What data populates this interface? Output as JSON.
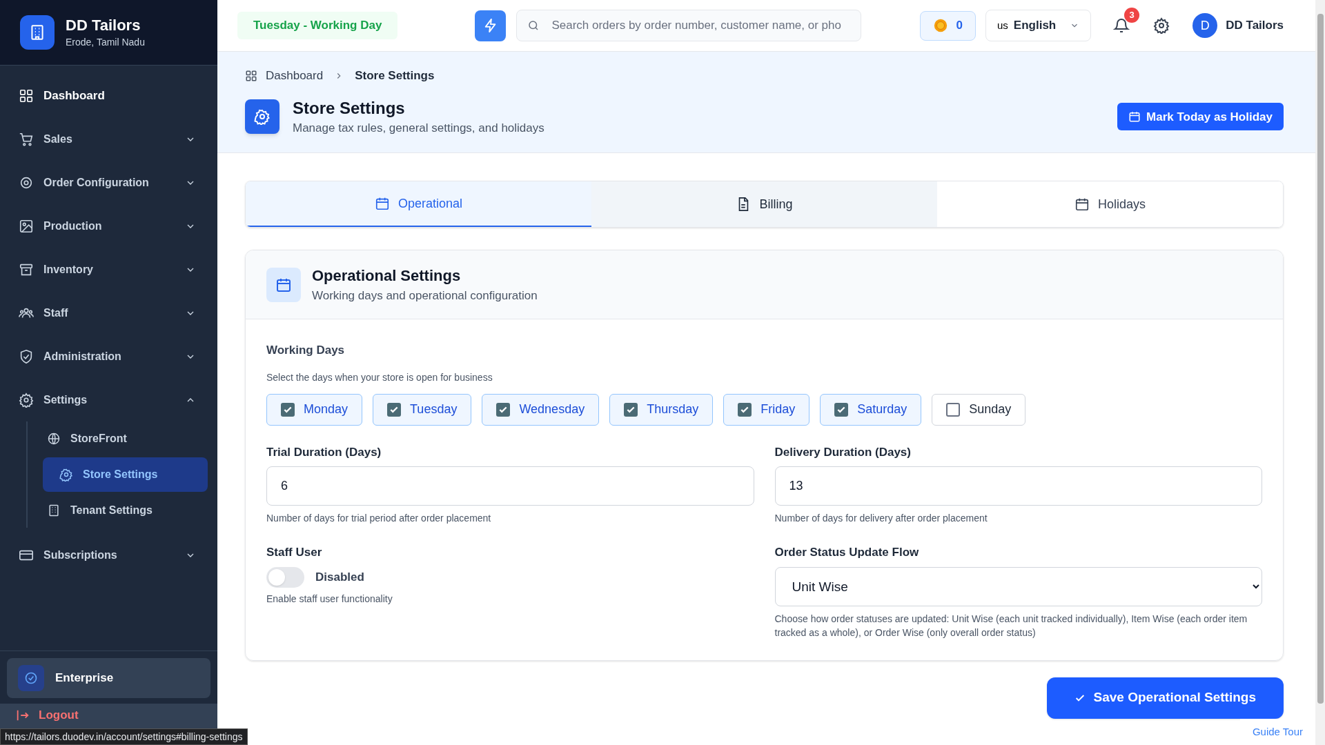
{
  "brand": {
    "name": "DD Tailors",
    "location": "Erode, Tamil Nadu"
  },
  "sidebar": {
    "items": [
      {
        "label": "Dashboard",
        "kind": "link"
      },
      {
        "label": "Sales",
        "kind": "group",
        "expanded": false
      },
      {
        "label": "Order Configuration",
        "kind": "group",
        "expanded": false
      },
      {
        "label": "Production",
        "kind": "group",
        "expanded": false
      },
      {
        "label": "Inventory",
        "kind": "group",
        "expanded": false
      },
      {
        "label": "Staff",
        "kind": "group",
        "expanded": false
      },
      {
        "label": "Administration",
        "kind": "group",
        "expanded": false
      },
      {
        "label": "Settings",
        "kind": "group",
        "expanded": true,
        "children": [
          {
            "label": "StoreFront",
            "selected": false
          },
          {
            "label": "Store Settings",
            "selected": true
          },
          {
            "label": "Tenant Settings",
            "selected": false
          }
        ]
      },
      {
        "label": "Subscriptions",
        "kind": "group",
        "expanded": false
      }
    ],
    "plan": "Enterprise",
    "logout": "Logout"
  },
  "header": {
    "day_status": "Tuesday - Working Day",
    "search": {
      "placeholder": "Search orders by order number, customer name, or pho"
    },
    "coins": "0",
    "language": {
      "flag": "us",
      "label": "English"
    },
    "notifications": "3",
    "user": {
      "initial": "D",
      "name": "DD Tailors"
    }
  },
  "breadcrumb": [
    "Dashboard",
    "Store Settings"
  ],
  "page": {
    "title": "Store Settings",
    "subtitle": "Manage tax rules, general settings, and holidays",
    "holiday_button": "Mark Today as Holiday"
  },
  "tabs": [
    {
      "label": "Operational",
      "selected": true
    },
    {
      "label": "Billing",
      "selected": false
    },
    {
      "label": "Holidays",
      "selected": false
    }
  ],
  "section": {
    "title": "Operational Settings",
    "subtitle": "Working days and operational configuration"
  },
  "working_days": {
    "label": "Working Days",
    "hint": "Select the days when your store is open for business",
    "days": [
      {
        "label": "Monday",
        "checked": true
      },
      {
        "label": "Tuesday",
        "checked": true
      },
      {
        "label": "Wednesday",
        "checked": true
      },
      {
        "label": "Thursday",
        "checked": true
      },
      {
        "label": "Friday",
        "checked": true
      },
      {
        "label": "Saturday",
        "checked": true
      },
      {
        "label": "Sunday",
        "checked": false
      }
    ]
  },
  "trial_duration": {
    "label": "Trial Duration (Days)",
    "value": "6",
    "hint": "Number of days for trial period after order placement"
  },
  "delivery_duration": {
    "label": "Delivery Duration (Days)",
    "value": "13",
    "hint": "Number of days for delivery after order placement"
  },
  "staff_user": {
    "label": "Staff User",
    "on": false,
    "state_label": "Disabled",
    "hint": "Enable staff user functionality"
  },
  "order_status_flow": {
    "label": "Order Status Update Flow",
    "value": "Unit Wise",
    "hint": "Choose how order statuses are updated: Unit Wise (each unit tracked individually), Item Wise (each order item tracked as a whole), or Order Wise (only overall order status)"
  },
  "save_button": "Save Operational Settings",
  "status_url": "https://tailors.duodev.in/account/settings#billing-settings",
  "guide_tour": "Guide Tour"
}
